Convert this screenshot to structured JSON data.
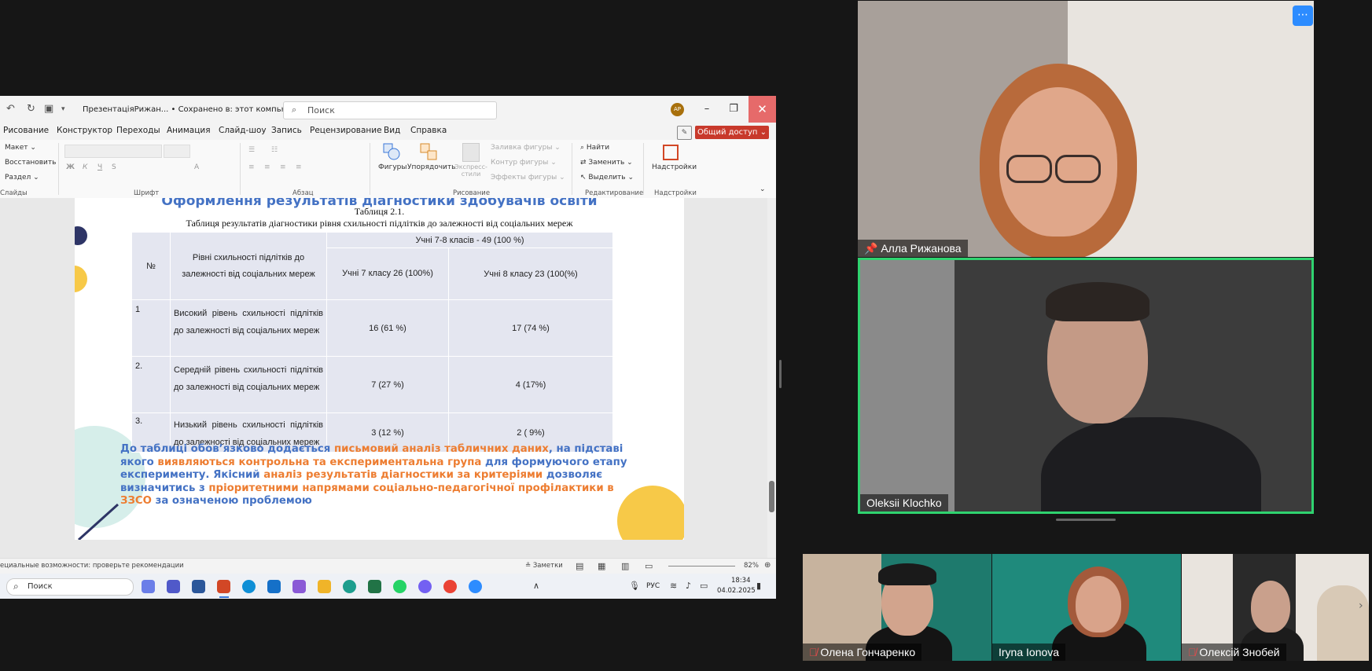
{
  "ppt": {
    "doc_title": "ПрезентаціяРижан...  • Сохранено в: этот компьютер ⌄",
    "search_placeholder": "Поиск",
    "avatar_initials": "АР",
    "share_label": "Общий доступ ⌄",
    "tabs": [
      "Рисование",
      "Конструктор",
      "Переходы",
      "Анимация",
      "Слайд-шоу",
      "Запись",
      "Рецензирование",
      "Вид",
      "Справка"
    ],
    "ribbon": {
      "slides_items": [
        "Макет ⌄",
        "Восстановить",
        "Раздел ⌄"
      ],
      "slides_label": "Слайды",
      "font_label": "Шрифт",
      "paragraph_label": "Абзац",
      "drawing_label": "Рисование",
      "editing_label": "Редактирование",
      "addins_label": "Надстройки",
      "shapes": "Фигуры",
      "arrange": "Упорядочить",
      "quick_styles": "Экспресс-стили",
      "shape_fill": "Заливка фигуры ⌄",
      "shape_outline": "Контур фигуры ⌄",
      "shape_effects": "Эффекты фигуры ⌄",
      "find": "Найти",
      "replace": "Заменить ⌄",
      "select": "Выделить ⌄",
      "addins": "Надстройки"
    },
    "slide": {
      "title": "Оформлення результатів діагностики здобувачів освіти",
      "table_caption": "Таблиця 2.1.",
      "table_title": "Таблиця результатів діагностики рівня схильності підлітків до залежності від соціальних мереж",
      "table": {
        "col_no": "№",
        "col_level": "Рівні схильності підлітків до залежності від соціальних мереж",
        "group_header": "Учні 7-8 класів - 49 (100 %)",
        "col_7": "Учні 7 класу 26 (100%)",
        "col_8": "Учні 8 класу 23 (100(%)",
        "rows": [
          {
            "no": "1",
            "level": "Високий рівень схильності підлітків до залежності від соціальних мереж",
            "c7": "16 (61 %)",
            "c8": "17 (74 %)"
          },
          {
            "no": "2.",
            "level": "Середній рівень схильності підлітків до залежності від соціальних мереж",
            "c7": "7 (27 %)",
            "c8": "4 (17%)"
          },
          {
            "no": "3.",
            "level": "Низький рівень схильності підлітків до залежності від соціальних мереж",
            "c7": "3 (12 %)",
            "c8": "2 ( 9%)"
          }
        ]
      },
      "summary": [
        {
          "t": "До таблиці обов’язково додається ",
          "c": "b"
        },
        {
          "t": "письмовий аналіз табличних даних",
          "c": "o"
        },
        {
          "t": ", на підставі якого ",
          "c": "b"
        },
        {
          "t": "виявляються контрольна та експериментальна група",
          "c": "o"
        },
        {
          "t": " для формуючого етапу експерименту. Якісний ",
          "c": "b"
        },
        {
          "t": "аналіз результатів діагностики за критеріями",
          "c": "o"
        },
        {
          "t": " дозволяє визначитись з ",
          "c": "b"
        },
        {
          "t": "пріоритетними напрямами соціально-педагогічної профілактики в ЗЗСО",
          "c": "o"
        },
        {
          "t": " за означеною проблемою",
          "c": "b"
        }
      ]
    },
    "status": {
      "accessibility": "ециальные возможности: проверьте рекомендации",
      "notes": "Заметки",
      "zoom": "82%"
    },
    "taskbar": {
      "search": "Поиск",
      "lang": "РУС",
      "time": "18:34",
      "date": "04.02.2025"
    }
  },
  "zoom_tiles": {
    "main": [
      {
        "name": "Алла Рижанова"
      },
      {
        "name": "Oleksii Klochko"
      }
    ],
    "strip": [
      {
        "name": "Олена Гончаренко"
      },
      {
        "name": "Iryna Ionova"
      },
      {
        "name": "Олексій Знобей"
      }
    ],
    "menu_icon": "⋯"
  },
  "colors": {
    "accent_blue": "#4472c4",
    "accent_orange": "#ed7d31",
    "active_speaker": "#2fd36f",
    "share_red": "#c8392b"
  }
}
